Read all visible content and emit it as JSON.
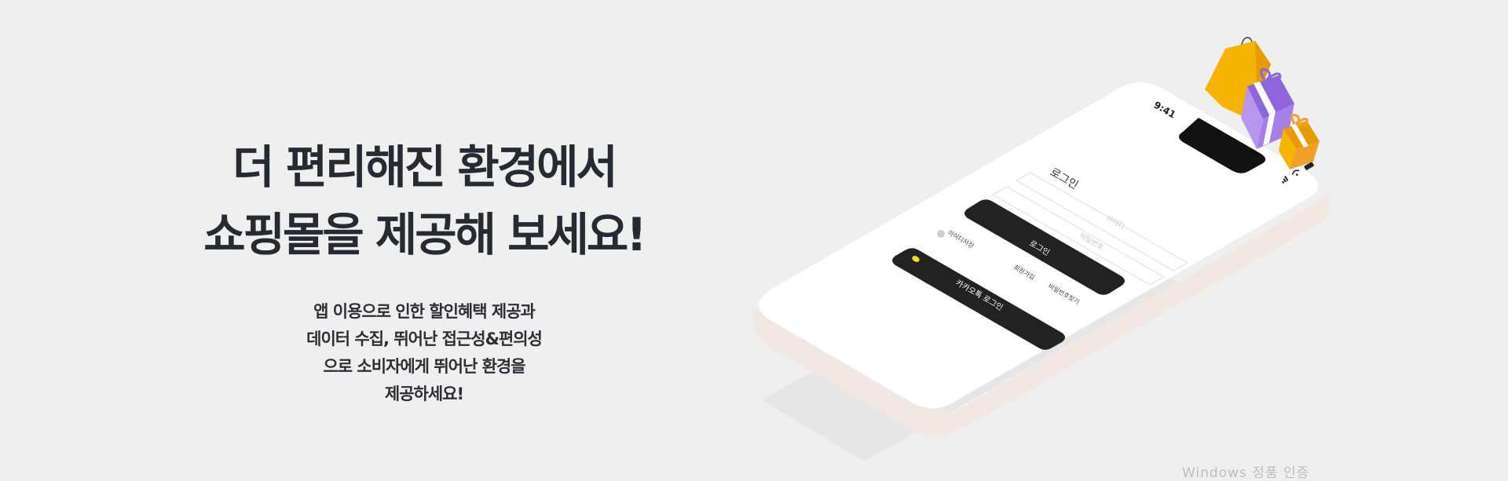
{
  "hero": {
    "headline_line1": "더 편리해진 환경에서",
    "headline_line2": "쇼핑몰을 제공해 보세요!",
    "sub_line1": "앱 이용으로 인한 할인혜택 제공과",
    "sub_line2": "데이터 수집, 뛰어난 접근성&편의성",
    "sub_line3": "으로 소비자에게 뛰어난 환경을",
    "sub_line4": "제공하세요!"
  },
  "phone": {
    "time": "9:41",
    "screen_title": "로그인",
    "id_placeholder": "아이디",
    "password_placeholder": "비밀번호",
    "save_id_label": "아이디저장",
    "login_button": "로그인",
    "signup_link": "회원가입",
    "find_password_link": "비밀번호찾기",
    "kakao_login_button": "카카오톡 로그인"
  },
  "watermark": "Windows 정품 인증",
  "colors": {
    "background": "#efefef",
    "text_dark": "#262a33",
    "button_dark": "#222222",
    "bag_yellow": "#f5b400",
    "gift_purple": "#a77fe6",
    "gift_orange": "#f0a02a"
  }
}
